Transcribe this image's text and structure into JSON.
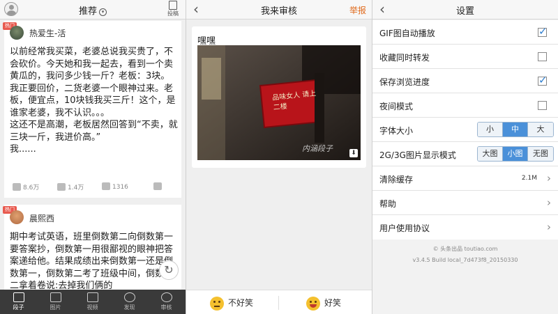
{
  "feed": {
    "title": "推荐",
    "submit_label": "投稿",
    "posts": [
      {
        "tag": "热门",
        "author": "热爱生-活",
        "text": "以前经常我买菜，老婆总说我买贵了，不会砍价。今天她和我一起去，看到一个卖黄瓜的，我问多少钱一斤？老板：3块。\n我正要回价，二货老婆一个眼神过来。老板，便宜点，10块钱我买三斤！这个，是谁家老婆，我不认识。。。\n这还不是高潮，老板居然回答到“不卖，就三块一斤，我进价高。”\n我......",
        "likes": "8.6万",
        "dislikes": "1.4万",
        "comments": "1316"
      },
      {
        "tag": "热门",
        "author": "晨熙西",
        "text": "期中考试英语，班里倒数第二向倒数第一要答案抄，倒数第一用很鄙视的眼神把答案递给他。结果成绩出来倒数第一还是倒数第一，倒数第二考了班级中间，倒数第二拿着卷说:去掉我们俩的"
      }
    ],
    "nav": [
      "段子",
      "图片",
      "视频",
      "发现",
      "审核"
    ]
  },
  "review": {
    "title": "我来审核",
    "report_label": "举报",
    "card_title": "嘿嘿",
    "sign_text": "品味女人 请上二楼",
    "watermark": "内涵段子",
    "bad_label": "不好笑",
    "good_label": "好笑"
  },
  "settings": {
    "title": "设置",
    "items": [
      {
        "label": "GIF图自动播放",
        "checked": true
      },
      {
        "label": "收藏同时转发",
        "checked": false
      },
      {
        "label": "保存浏览进度",
        "checked": true
      },
      {
        "label": "夜间模式",
        "checked": false
      }
    ],
    "font_size_label": "字体大小",
    "font_options": [
      "小",
      "中",
      "大"
    ],
    "font_selected": "中",
    "image_mode_label": "2G/3G图片显示模式",
    "image_options": [
      "大图",
      "小图",
      "无图"
    ],
    "image_selected": "小图",
    "clear_cache_label": "清除缓存",
    "cache_size": "2.1M",
    "help_label": "帮助",
    "agreement_label": "用户使用协议",
    "footer_line1": "© 头条出品 toutiao.com",
    "footer_line2": "v3.4.5 Build local_7d473f8_20150330",
    "accent": "#4a90d9"
  }
}
